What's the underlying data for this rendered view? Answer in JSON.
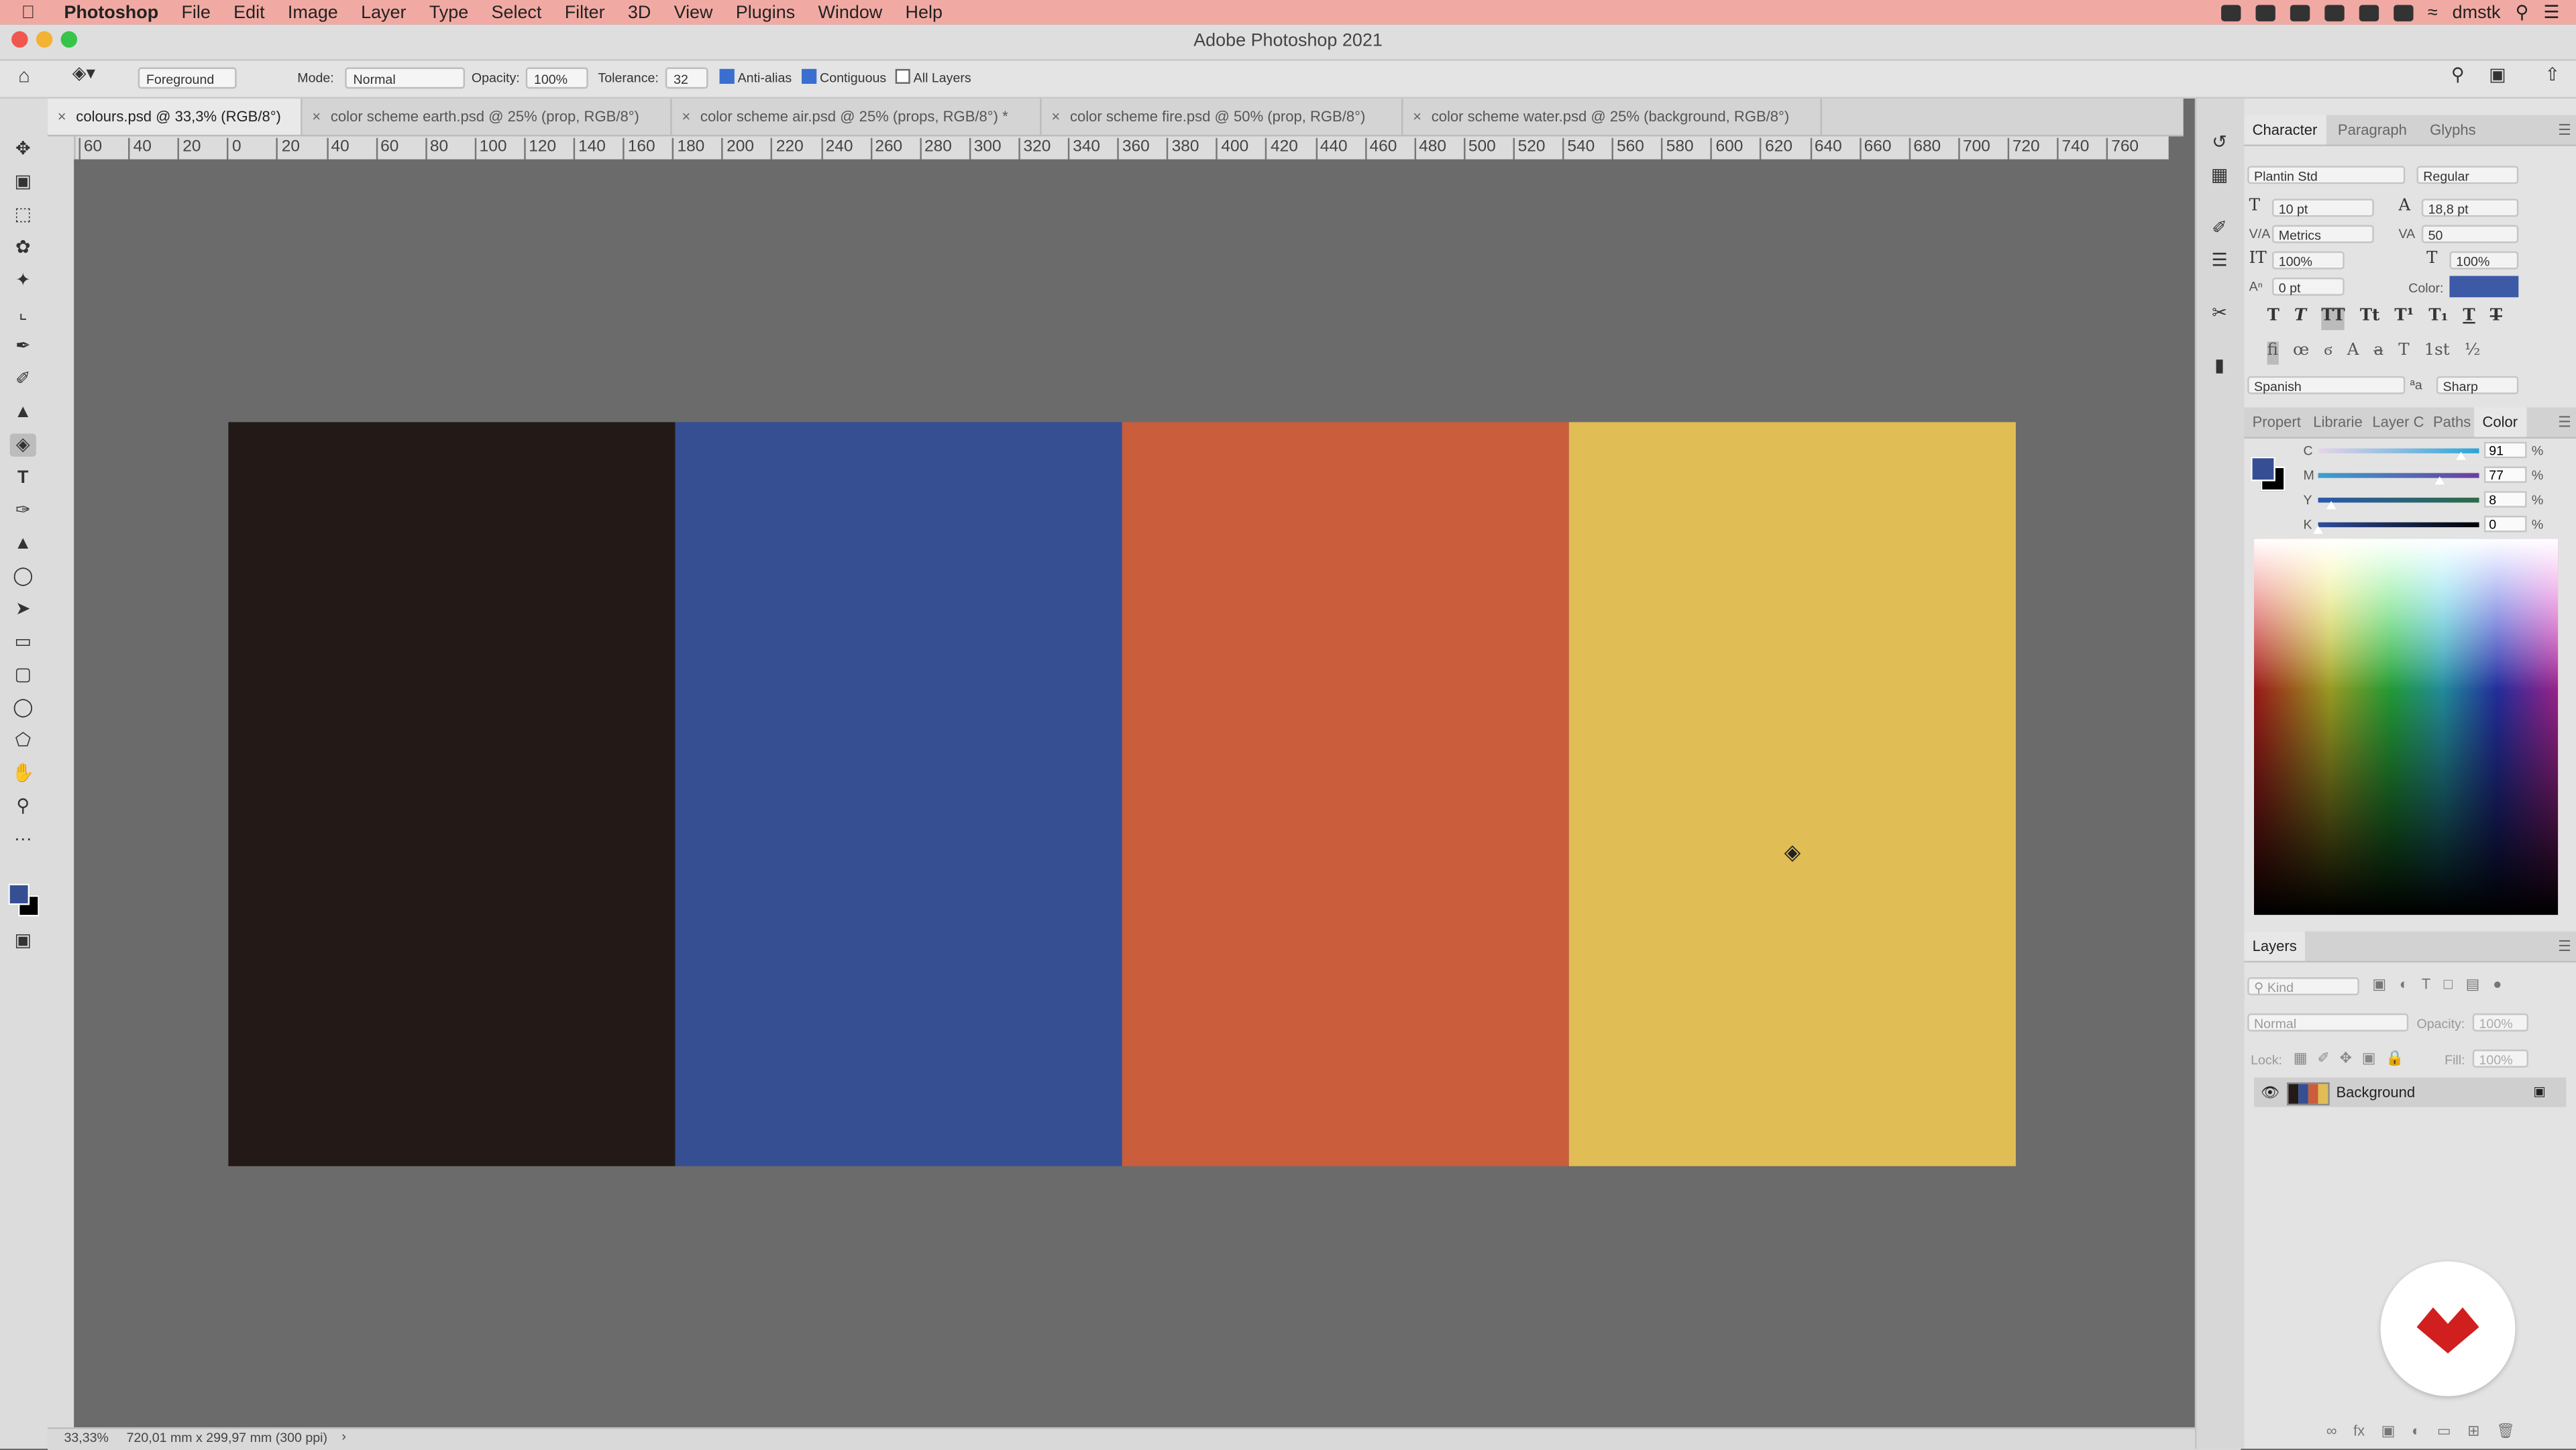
{
  "menubar": {
    "app_name": "Photoshop",
    "items": [
      "File",
      "Edit",
      "Image",
      "Layer",
      "Type",
      "Select",
      "Filter",
      "3D",
      "View",
      "Plugins",
      "Window",
      "Help"
    ],
    "user": "dmstk"
  },
  "window": {
    "title": "Adobe Photoshop 2021"
  },
  "options": {
    "fill_source": "Foreground",
    "mode_label": "Mode:",
    "mode_value": "Normal",
    "opacity_label": "Opacity:",
    "opacity_value": "100%",
    "tolerance_label": "Tolerance:",
    "tolerance_value": "32",
    "anti_alias": "Anti-alias",
    "contiguous": "Contiguous",
    "all_layers": "All Layers"
  },
  "tabs": [
    {
      "label": "colours.psd @ 33,3% (RGB/8°)",
      "active": true
    },
    {
      "label": "color scheme earth.psd @ 25% (prop, RGB/8°)",
      "active": false
    },
    {
      "label": "color scheme air.psd @ 25% (props, RGB/8°) *",
      "active": false
    },
    {
      "label": "color scheme fire.psd @ 50% (prop, RGB/8°)",
      "active": false
    },
    {
      "label": "color scheme water.psd @ 25% (background, RGB/8°)",
      "active": false
    }
  ],
  "ruler_h": [
    "60",
    "40",
    "20",
    "0",
    "20",
    "40",
    "60",
    "80",
    "100",
    "120",
    "140",
    "160",
    "180",
    "200",
    "220",
    "240",
    "260",
    "280",
    "300",
    "320",
    "340",
    "360",
    "380",
    "400",
    "420",
    "440",
    "460",
    "480",
    "500",
    "520",
    "540",
    "560",
    "580",
    "600",
    "620",
    "640",
    "660",
    "680",
    "700",
    "720",
    "740",
    "760"
  ],
  "canvas": {
    "swatches": [
      "#231a18",
      "#364f93",
      "#c95d3c",
      "#e0bd55"
    ]
  },
  "status": {
    "zoom": "33,33%",
    "doc_info": "720,01 mm x 299,97 mm (300 ppi)"
  },
  "character": {
    "tabs": [
      "Character",
      "Paragraph",
      "Glyphs"
    ],
    "font_family": "Plantin Std",
    "font_style": "Regular",
    "size": "10 pt",
    "leading": "18,8 pt",
    "kerning": "Metrics",
    "tracking": "50",
    "vscale": "100%",
    "hscale": "100%",
    "baseline": "0 pt",
    "color_label": "Color:",
    "text_color": "#3d5aa6",
    "language": "Spanish",
    "antialias": "Sharp"
  },
  "color_panel": {
    "tabs": [
      "Propert",
      "Librarie",
      "Layer C",
      "Paths",
      "Color"
    ],
    "channels": [
      {
        "label": "C",
        "value": "91",
        "pct": "%",
        "pos": 0.89
      },
      {
        "label": "M",
        "value": "77",
        "pct": "%",
        "pos": 0.75
      },
      {
        "label": "Y",
        "value": "8",
        "pct": "%",
        "pos": 0.08
      },
      {
        "label": "K",
        "value": "0",
        "pct": "%",
        "pos": 0.0
      }
    ],
    "foreground": "#364f93",
    "background": "#000000"
  },
  "layers": {
    "title": "Layers",
    "kind_placeholder": "Kind",
    "blend": "Normal",
    "opacity_label": "Opacity:",
    "opacity_value": "100%",
    "lock_label": "Lock:",
    "fill_label": "Fill:",
    "fill_value": "100%",
    "items": [
      {
        "name": "Background"
      }
    ]
  }
}
